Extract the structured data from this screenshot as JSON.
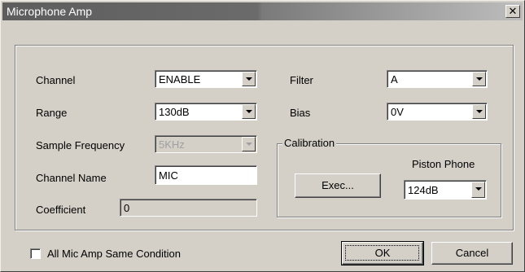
{
  "window": {
    "title": "Microphone Amp",
    "close_glyph": "✕"
  },
  "fields": {
    "channel": {
      "label": "Channel",
      "value": "ENABLE"
    },
    "range": {
      "label": "Range",
      "value": "130dB"
    },
    "sample_frequency": {
      "label": "Sample Frequency",
      "value": "5KHz",
      "disabled": true
    },
    "channel_name": {
      "label": "Channel Name",
      "value": "MIC"
    },
    "coefficient": {
      "label": "Coefficient",
      "value": "0"
    },
    "filter": {
      "label": "Filter",
      "value": "A"
    },
    "bias": {
      "label": "Bias",
      "value": "0V"
    }
  },
  "calibration": {
    "legend": "Calibration",
    "exec_label": "Exec...",
    "piston_phone_label": "Piston Phone",
    "piston_phone_value": "124dB"
  },
  "footer": {
    "checkbox_label": "All Mic Amp Same Condition",
    "checkbox_checked": false,
    "ok_label": "OK",
    "cancel_label": "Cancel"
  }
}
